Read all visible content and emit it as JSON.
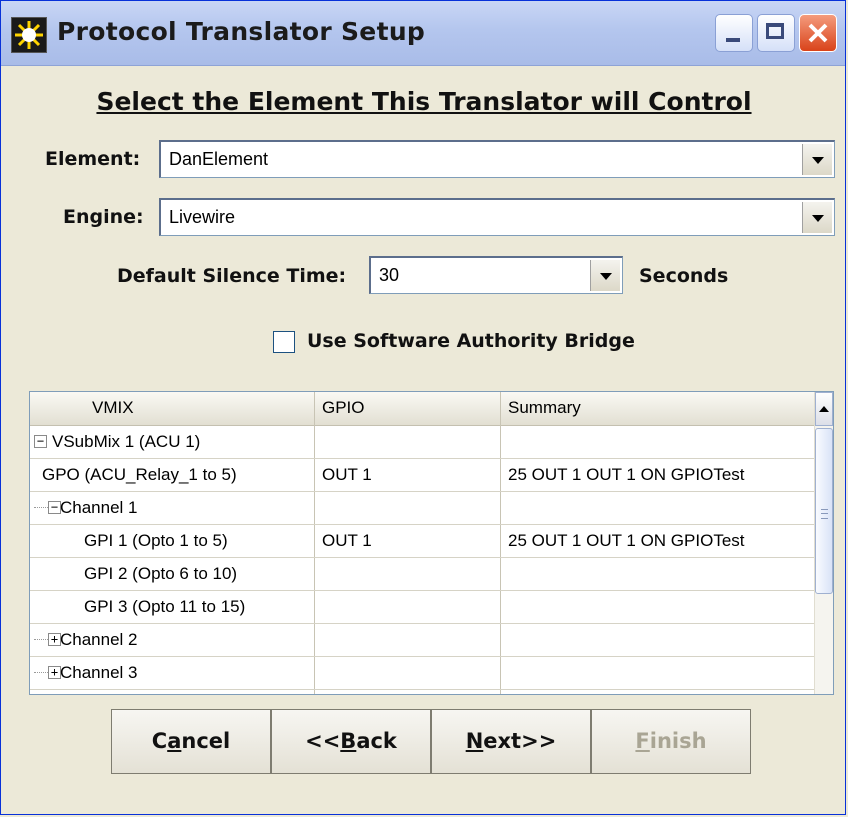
{
  "window": {
    "title": "Protocol Translator Setup",
    "icon": "sunburst-icon",
    "controls": [
      "minimize-icon",
      "maximize-icon",
      "close-icon"
    ]
  },
  "heading": "Select the Element This Translator will Control",
  "element": {
    "label": "Element:",
    "value": "DanElement"
  },
  "engine": {
    "label": "Engine:",
    "value": "Livewire"
  },
  "silence": {
    "label": "Default Silence Time:",
    "value": "30",
    "unit": "Seconds"
  },
  "bridge": {
    "label": "Use Software Authority Bridge",
    "checked": false
  },
  "grid": {
    "columns": [
      "VMIX",
      "GPIO",
      "Summary"
    ],
    "rows": [
      {
        "tree": "−",
        "name": "VSubMix 1  (ACU 1)",
        "gpio": "",
        "summary": ""
      },
      {
        "tree": "",
        "name": "GPO (ACU_Relay_1 to 5)",
        "gpio": "OUT 1",
        "summary": "25  OUT 1   OUT 1 ON GPIOTest"
      },
      {
        "tree": "−",
        "name": "Channel 1",
        "gpio": "",
        "summary": ""
      },
      {
        "tree": "",
        "name": "GPI 1  (Opto 1 to 5)",
        "gpio": "OUT 1",
        "summary": "25  OUT 1   OUT 1 ON GPIOTest"
      },
      {
        "tree": "",
        "name": "GPI 2  (Opto 6 to 10)",
        "gpio": "",
        "summary": ""
      },
      {
        "tree": "",
        "name": "GPI 3  (Opto 11 to 15)",
        "gpio": "",
        "summary": ""
      },
      {
        "tree": "+",
        "name": "Channel 2",
        "gpio": "",
        "summary": ""
      },
      {
        "tree": "+",
        "name": "Channel 3",
        "gpio": "",
        "summary": ""
      }
    ]
  },
  "buttons": {
    "cancel": {
      "pre": "C",
      "mnemonic": "a",
      "post": "ncel"
    },
    "back": {
      "pre": "<<",
      "mnemonic": "B",
      "post": "ack"
    },
    "next": {
      "pre": "",
      "mnemonic": "N",
      "post": "ext>>"
    },
    "finish": {
      "pre": "",
      "mnemonic": "F",
      "post": "inish",
      "disabled": true
    }
  },
  "colors": {
    "titlebar": "#b4c6ee",
    "dialog_bg": "#ece9d8",
    "close_button": "#d9431a"
  }
}
